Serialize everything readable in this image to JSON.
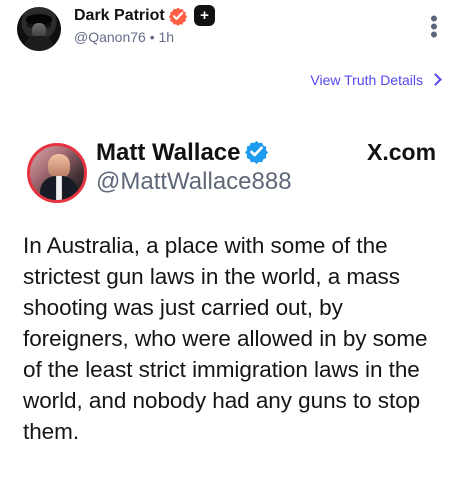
{
  "post": {
    "author_name": "Dark Patriot",
    "author_handle_time": "@Qanon76 • 1h",
    "details_link": "View Truth Details",
    "embedded": {
      "name": "Matt Wallace",
      "handle": "@MattWallace888",
      "source": "X.com",
      "text": "In Australia, a place with some of the strictest gun laws in the world, a mass shooting was just carried out, by foreigners, who were allowed in by some of the least strict immigration laws in the world, and nobody had any guns to stop them."
    }
  },
  "icons": {
    "verified_orange": "verified-badge-orange-icon",
    "plus": "plus-badge-icon",
    "more": "more-vertical-icon",
    "chevron": "chevron-right-icon",
    "verified_blue": "verified-badge-blue-icon"
  },
  "colors": {
    "verified_orange": "#ff5f45",
    "link_purple": "#5448ee",
    "verified_blue": "#1d9bf0",
    "muted_text": "#646d86"
  }
}
